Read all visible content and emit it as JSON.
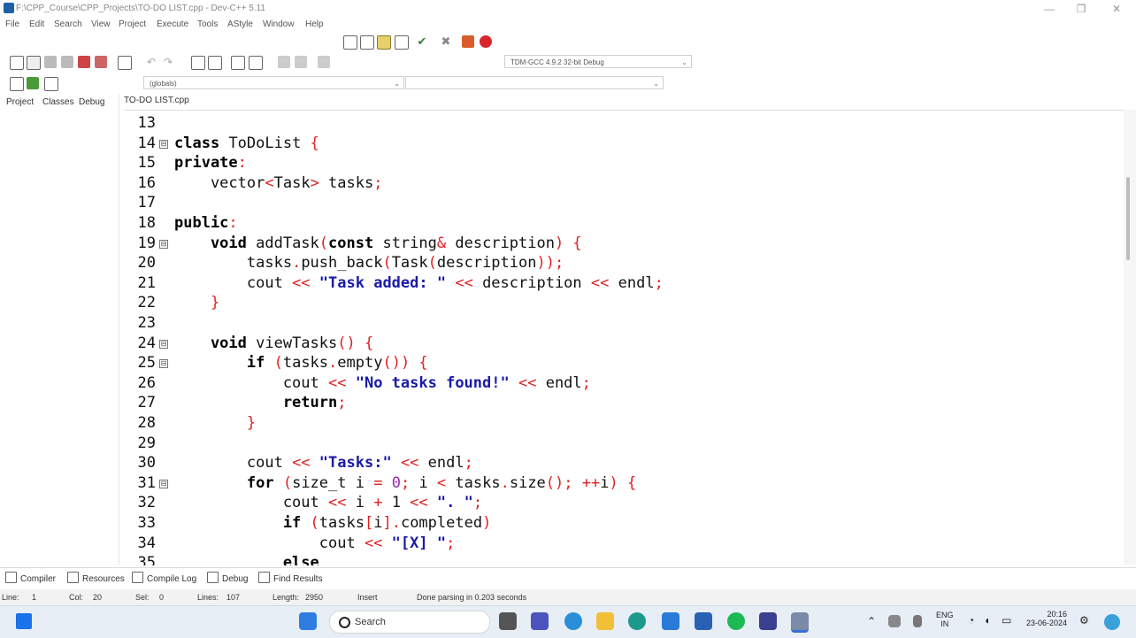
{
  "window": {
    "title": "F:\\CPP_Course\\CPP_Projects\\TO-DO LIST.cpp - Dev-C++ 5.11",
    "controls": [
      "—",
      "❐",
      "✕"
    ]
  },
  "menu": [
    "File",
    "Edit",
    "Search",
    "View",
    "Project",
    "Execute",
    "Tools",
    "AStyle",
    "Window",
    "Help"
  ],
  "toolbar": {
    "compiler_select": "TDM-GCC 4.9.2 32-bit Debug",
    "scope_select": "(globals)",
    "member_select": ""
  },
  "left_tabs": [
    "Project",
    "Classes",
    "Debug"
  ],
  "editor": {
    "file_tab": "TO-DO LIST.cpp",
    "lines": [
      {
        "n": "13",
        "fold": "",
        "tokens": [
          {
            "t": "",
            "c": "tx"
          }
        ]
      },
      {
        "n": "14",
        "fold": "⊟",
        "tokens": [
          {
            "t": "class",
            "c": "kw"
          },
          {
            "t": " ToDoList ",
            "c": "tx"
          },
          {
            "t": "{",
            "c": "sy"
          }
        ]
      },
      {
        "n": "15",
        "fold": "",
        "tokens": [
          {
            "t": "private",
            "c": "kw"
          },
          {
            "t": ":",
            "c": "sy"
          }
        ]
      },
      {
        "n": "16",
        "fold": "",
        "tokens": [
          {
            "t": "    vector",
            "c": "tx"
          },
          {
            "t": "<",
            "c": "sy"
          },
          {
            "t": "Task",
            "c": "tx"
          },
          {
            "t": ">",
            "c": "sy"
          },
          {
            "t": " tasks",
            "c": "tx"
          },
          {
            "t": ";",
            "c": "sy"
          }
        ]
      },
      {
        "n": "17",
        "fold": "",
        "tokens": [
          {
            "t": "",
            "c": "tx"
          }
        ]
      },
      {
        "n": "18",
        "fold": "",
        "tokens": [
          {
            "t": "public",
            "c": "kw"
          },
          {
            "t": ":",
            "c": "sy"
          }
        ]
      },
      {
        "n": "19",
        "fold": "⊟",
        "tokens": [
          {
            "t": "    void",
            "c": "kw"
          },
          {
            "t": " addTask",
            "c": "tx"
          },
          {
            "t": "(",
            "c": "sy"
          },
          {
            "t": "const",
            "c": "kw"
          },
          {
            "t": " string",
            "c": "tx"
          },
          {
            "t": "&",
            "c": "sy"
          },
          {
            "t": " description",
            "c": "tx"
          },
          {
            "t": ") {",
            "c": "sy"
          }
        ]
      },
      {
        "n": "20",
        "fold": "",
        "tokens": [
          {
            "t": "        tasks",
            "c": "tx"
          },
          {
            "t": ".",
            "c": "sy"
          },
          {
            "t": "push_back",
            "c": "tx"
          },
          {
            "t": "(",
            "c": "sy"
          },
          {
            "t": "Task",
            "c": "tx"
          },
          {
            "t": "(",
            "c": "sy"
          },
          {
            "t": "description",
            "c": "tx"
          },
          {
            "t": "));",
            "c": "sy"
          }
        ]
      },
      {
        "n": "21",
        "fold": "",
        "tokens": [
          {
            "t": "        cout ",
            "c": "tx"
          },
          {
            "t": "<<",
            "c": "sy"
          },
          {
            "t": " ",
            "c": "tx"
          },
          {
            "t": "\"Task added: \"",
            "c": "st"
          },
          {
            "t": " ",
            "c": "tx"
          },
          {
            "t": "<<",
            "c": "sy"
          },
          {
            "t": " description ",
            "c": "tx"
          },
          {
            "t": "<<",
            "c": "sy"
          },
          {
            "t": " endl",
            "c": "tx"
          },
          {
            "t": ";",
            "c": "sy"
          }
        ]
      },
      {
        "n": "22",
        "fold": "",
        "tokens": [
          {
            "t": "    ",
            "c": "tx"
          },
          {
            "t": "}",
            "c": "sy"
          }
        ]
      },
      {
        "n": "23",
        "fold": "",
        "tokens": [
          {
            "t": "",
            "c": "tx"
          }
        ]
      },
      {
        "n": "24",
        "fold": "⊟",
        "tokens": [
          {
            "t": "    void",
            "c": "kw"
          },
          {
            "t": " viewTasks",
            "c": "tx"
          },
          {
            "t": "() {",
            "c": "sy"
          }
        ]
      },
      {
        "n": "25",
        "fold": "⊟",
        "tokens": [
          {
            "t": "        if",
            "c": "kw"
          },
          {
            "t": " (",
            "c": "sy"
          },
          {
            "t": "tasks",
            "c": "tx"
          },
          {
            "t": ".",
            "c": "sy"
          },
          {
            "t": "empty",
            "c": "tx"
          },
          {
            "t": "()) {",
            "c": "sy"
          }
        ]
      },
      {
        "n": "26",
        "fold": "",
        "tokens": [
          {
            "t": "            cout ",
            "c": "tx"
          },
          {
            "t": "<<",
            "c": "sy"
          },
          {
            "t": " ",
            "c": "tx"
          },
          {
            "t": "\"No tasks found!\"",
            "c": "st"
          },
          {
            "t": " ",
            "c": "tx"
          },
          {
            "t": "<<",
            "c": "sy"
          },
          {
            "t": " endl",
            "c": "tx"
          },
          {
            "t": ";",
            "c": "sy"
          }
        ]
      },
      {
        "n": "27",
        "fold": "",
        "tokens": [
          {
            "t": "            return",
            "c": "kw"
          },
          {
            "t": ";",
            "c": "sy"
          }
        ]
      },
      {
        "n": "28",
        "fold": "",
        "tokens": [
          {
            "t": "        ",
            "c": "tx"
          },
          {
            "t": "}",
            "c": "sy"
          }
        ]
      },
      {
        "n": "29",
        "fold": "",
        "tokens": [
          {
            "t": "",
            "c": "tx"
          }
        ]
      },
      {
        "n": "30",
        "fold": "",
        "tokens": [
          {
            "t": "        cout ",
            "c": "tx"
          },
          {
            "t": "<<",
            "c": "sy"
          },
          {
            "t": " ",
            "c": "tx"
          },
          {
            "t": "\"Tasks:\"",
            "c": "st"
          },
          {
            "t": " ",
            "c": "tx"
          },
          {
            "t": "<<",
            "c": "sy"
          },
          {
            "t": " endl",
            "c": "tx"
          },
          {
            "t": ";",
            "c": "sy"
          }
        ]
      },
      {
        "n": "31",
        "fold": "⊟",
        "tokens": [
          {
            "t": "        for",
            "c": "kw"
          },
          {
            "t": " (",
            "c": "sy"
          },
          {
            "t": "size_t i ",
            "c": "tx"
          },
          {
            "t": "=",
            "c": "sy"
          },
          {
            "t": " ",
            "c": "tx"
          },
          {
            "t": "0",
            "c": "nm"
          },
          {
            "t": ";",
            "c": "sy"
          },
          {
            "t": " i ",
            "c": "tx"
          },
          {
            "t": "<",
            "c": "sy"
          },
          {
            "t": " tasks",
            "c": "tx"
          },
          {
            "t": ".",
            "c": "sy"
          },
          {
            "t": "size",
            "c": "tx"
          },
          {
            "t": "();",
            "c": "sy"
          },
          {
            "t": " ",
            "c": "tx"
          },
          {
            "t": "++",
            "c": "sy"
          },
          {
            "t": "i",
            "c": "tx"
          },
          {
            "t": ") {",
            "c": "sy"
          }
        ]
      },
      {
        "n": "32",
        "fold": "",
        "tokens": [
          {
            "t": "            cout ",
            "c": "tx"
          },
          {
            "t": "<<",
            "c": "sy"
          },
          {
            "t": " i ",
            "c": "tx"
          },
          {
            "t": "+",
            "c": "sy"
          },
          {
            "t": " 1 ",
            "c": "tx"
          },
          {
            "t": "<<",
            "c": "sy"
          },
          {
            "t": " ",
            "c": "tx"
          },
          {
            "t": "\". \"",
            "c": "st"
          },
          {
            "t": ";",
            "c": "sy"
          }
        ]
      },
      {
        "n": "33",
        "fold": "",
        "tokens": [
          {
            "t": "            if",
            "c": "kw"
          },
          {
            "t": " (",
            "c": "sy"
          },
          {
            "t": "tasks",
            "c": "tx"
          },
          {
            "t": "[",
            "c": "sy"
          },
          {
            "t": "i",
            "c": "tx"
          },
          {
            "t": "].",
            "c": "sy"
          },
          {
            "t": "completed",
            "c": "tx"
          },
          {
            "t": ")",
            "c": "sy"
          }
        ]
      },
      {
        "n": "34",
        "fold": "",
        "tokens": [
          {
            "t": "                cout ",
            "c": "tx"
          },
          {
            "t": "<<",
            "c": "sy"
          },
          {
            "t": " ",
            "c": "tx"
          },
          {
            "t": "\"[X] \"",
            "c": "st"
          },
          {
            "t": ";",
            "c": "sy"
          }
        ]
      },
      {
        "n": "35",
        "fold": "",
        "tokens": [
          {
            "t": "            else",
            "c": "kw"
          }
        ]
      }
    ]
  },
  "bottom_tabs": [
    "Compiler",
    "Resources",
    "Compile Log",
    "Debug",
    "Find Results"
  ],
  "status": {
    "line_label": "Line:",
    "line_value": "1",
    "col_label": "Col:",
    "col_value": "20",
    "sel_label": "Sel:",
    "sel_value": "0",
    "lines_label": "Lines:",
    "lines_value": "107",
    "length_label": "Length:",
    "length_value": "2950",
    "mode": "Insert",
    "message": "Done parsing in 0.203 seconds"
  },
  "taskbar": {
    "search_label": "Search",
    "lang_top": "ENG",
    "lang_bottom": "IN",
    "time": "20:16",
    "date": "23-06-2024"
  },
  "colors": {
    "keyword": "#000000",
    "symbol": "#e02020",
    "string": "#1a1aa8",
    "number": "#9b2bb0"
  }
}
